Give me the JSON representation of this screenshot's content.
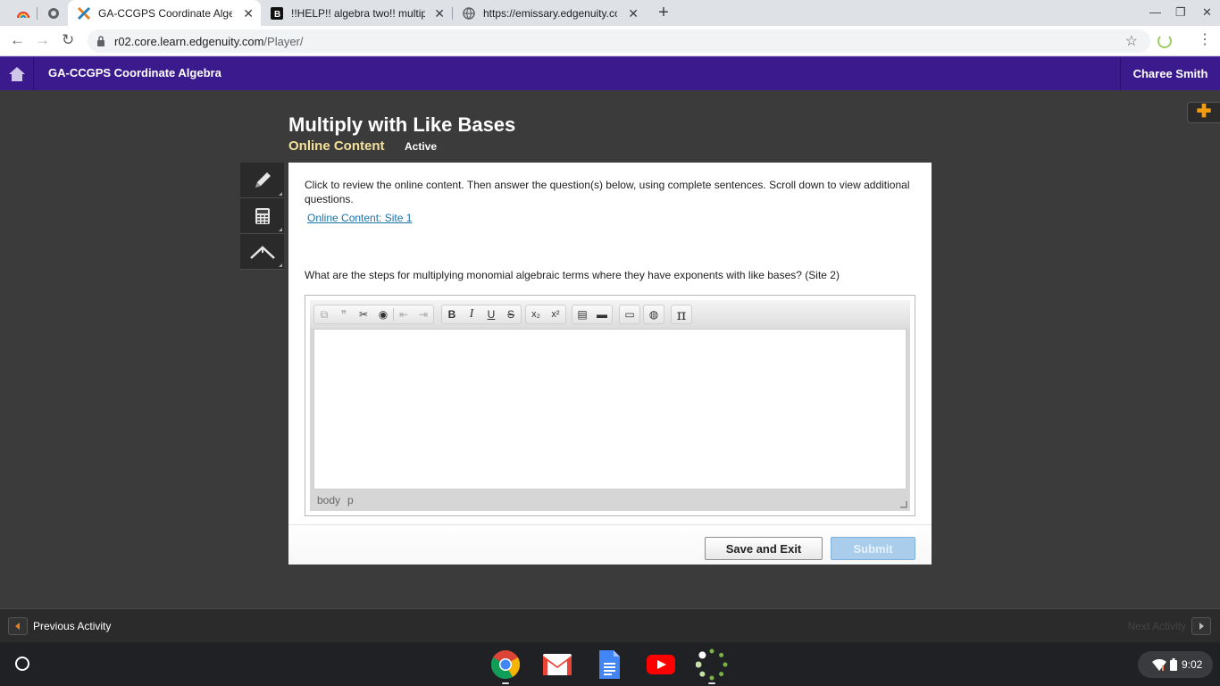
{
  "browser": {
    "tabs": [
      {
        "title": "",
        "active": false
      },
      {
        "title": "",
        "active": false
      },
      {
        "title": "GA-CCGPS Coordinate Algebra -",
        "active": true
      },
      {
        "title": "!!HELP!! algebra two!! multiply a",
        "active": false
      },
      {
        "title": "https://emissary.edgenuity.com/",
        "active": false
      }
    ],
    "url_host": "r02.core.learn.edgenuity.com",
    "url_path": "/Player/"
  },
  "app": {
    "course_title": "GA-CCGPS Coordinate Algebra",
    "user_name": "Charee Smith"
  },
  "activity": {
    "title": "Multiply with Like Bases",
    "subtitle": "Online Content",
    "status": "Active",
    "instructions": "Click to review the online content. Then answer the question(s) below, using complete sentences. Scroll down to view additional questions.",
    "link_text": "Online Content: Site 1",
    "question": "What are the steps for multiplying monomial algebraic terms where they have exponents with like bases? (Site 2)"
  },
  "editor": {
    "path": [
      "body",
      "p"
    ]
  },
  "buttons": {
    "save_exit": "Save and Exit",
    "submit": "Submit"
  },
  "nav": {
    "previous": "Previous Activity",
    "next": "Next Activity"
  },
  "system": {
    "clock": "9:02"
  },
  "colors": {
    "header": "#3a1a8c",
    "accent_title": "#f5e19a",
    "plus": "#f39c12"
  }
}
